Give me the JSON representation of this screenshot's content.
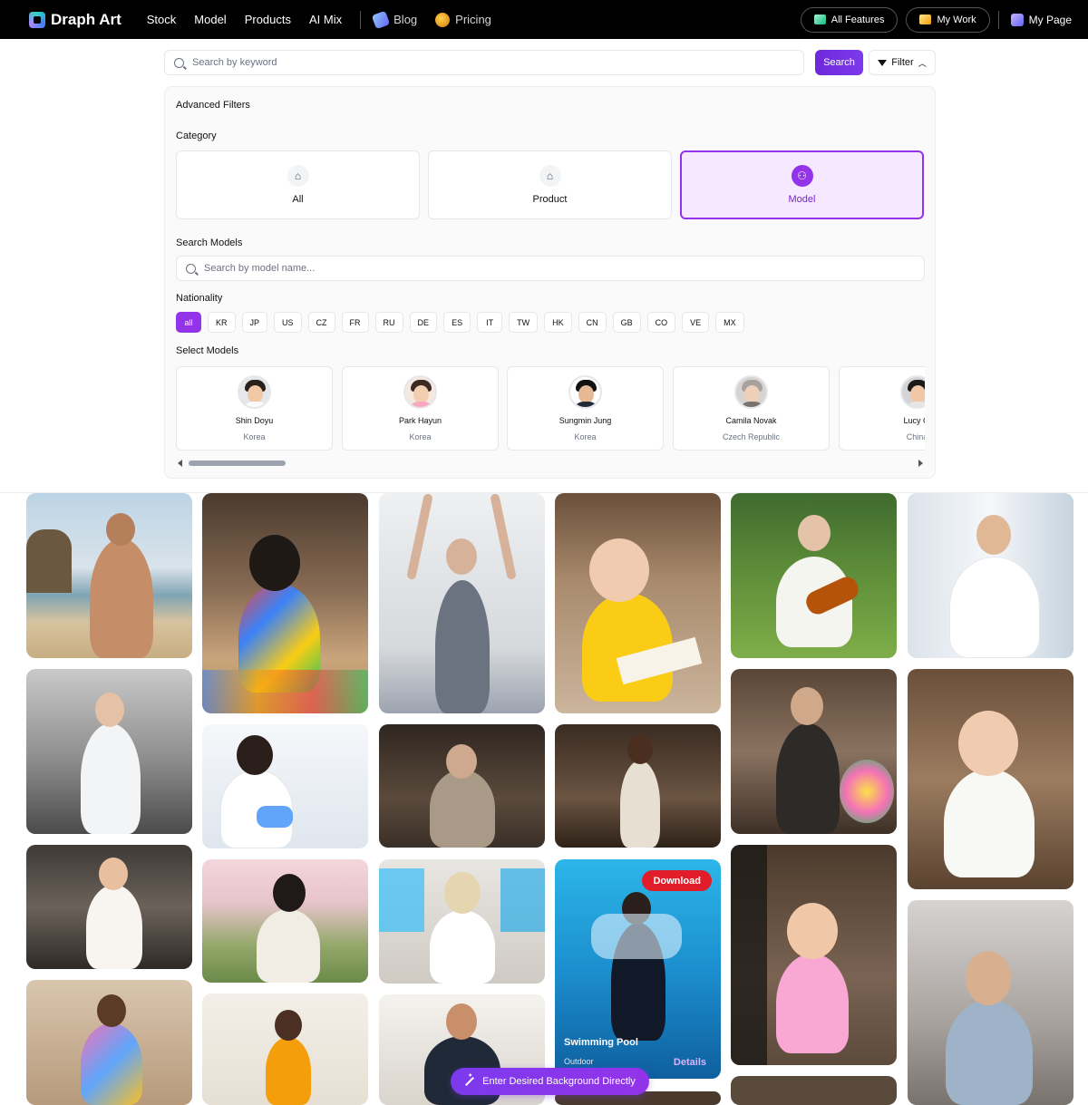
{
  "nav": {
    "brand": "Draph Art",
    "links": [
      "Stock",
      "Model",
      "Products",
      "AI Mix"
    ],
    "blog": "Blog",
    "pricing": "Pricing",
    "all_features": "All Features",
    "my_work": "My Work",
    "my_page": "My Page"
  },
  "search": {
    "placeholder": "Search by keyword",
    "button": "Search",
    "filter": "Filter"
  },
  "filters": {
    "title": "Advanced Filters",
    "category_label": "Category",
    "categories": [
      {
        "label": "All",
        "icon": "home-icon",
        "active": false
      },
      {
        "label": "Product",
        "icon": "home-icon",
        "active": false
      },
      {
        "label": "Model",
        "icon": "users-icon",
        "active": true
      }
    ],
    "search_models_label": "Search Models",
    "model_search_placeholder": "Search by model name...",
    "nationality_label": "Nationality",
    "nationalities": [
      "all",
      "KR",
      "JP",
      "US",
      "CZ",
      "FR",
      "RU",
      "DE",
      "ES",
      "IT",
      "TW",
      "HK",
      "CN",
      "GB",
      "CO",
      "VE",
      "MX"
    ],
    "active_nationality": "all",
    "select_models_label": "Select Models",
    "models": [
      {
        "name": "Shin Doyu",
        "nationality": "Korea"
      },
      {
        "name": "Park Hayun",
        "nationality": "Korea"
      },
      {
        "name": "Sungmin Jung",
        "nationality": "Korea"
      },
      {
        "name": "Camila Novak",
        "nationality": "Czech Republic"
      },
      {
        "name": "Lucy Cl",
        "nationality": "China"
      }
    ]
  },
  "gallery": {
    "hover_tile": {
      "download": "Download",
      "title": "Swimming Pool",
      "subtitle": "Outdoor",
      "details": "Details"
    }
  },
  "fab": {
    "label": "Enter Desired Background Directly"
  },
  "colors": {
    "accent": "#9333ea",
    "download": "#e11d2a",
    "nav_bg": "#000000"
  }
}
